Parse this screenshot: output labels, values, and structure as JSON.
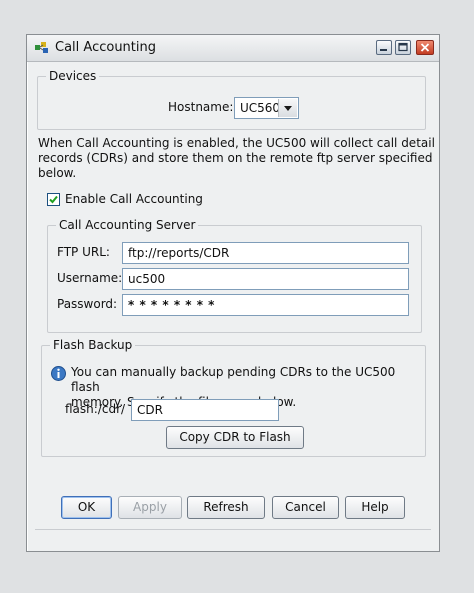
{
  "window": {
    "title": "Call Accounting"
  },
  "devices": {
    "legend": "Devices",
    "hostname_label": "Hostname:",
    "hostname_value": "UC560"
  },
  "description": {
    "line1": "When Call Accounting is enabled, the UC500 will collect call detail",
    "line2": "records (CDRs) and store them on the remote ftp server specified",
    "line3": "below."
  },
  "enable": {
    "label": "Enable Call Accounting",
    "checked": true
  },
  "server": {
    "legend": "Call Accounting Server",
    "ftp_label": "FTP URL:",
    "ftp_value": "ftp://reports/CDR",
    "username_label": "Username:",
    "username_value": "uc500",
    "password_label": "Password:",
    "password_value": "* * * * * * * *"
  },
  "flash": {
    "legend": "Flash Backup",
    "info_line1": "You can manually backup pending CDRs to the UC500 flash",
    "info_line2": "memory. Specify the file name below.",
    "path_label": "flash:/cdr/",
    "file_value": "CDR",
    "copy_label": "Copy CDR to Flash"
  },
  "buttons": {
    "ok": "OK",
    "apply": "Apply",
    "refresh": "Refresh",
    "cancel": "Cancel",
    "help": "Help"
  },
  "colors": {
    "info_icon": "#3b78c4",
    "close_button": "#c23c22"
  }
}
